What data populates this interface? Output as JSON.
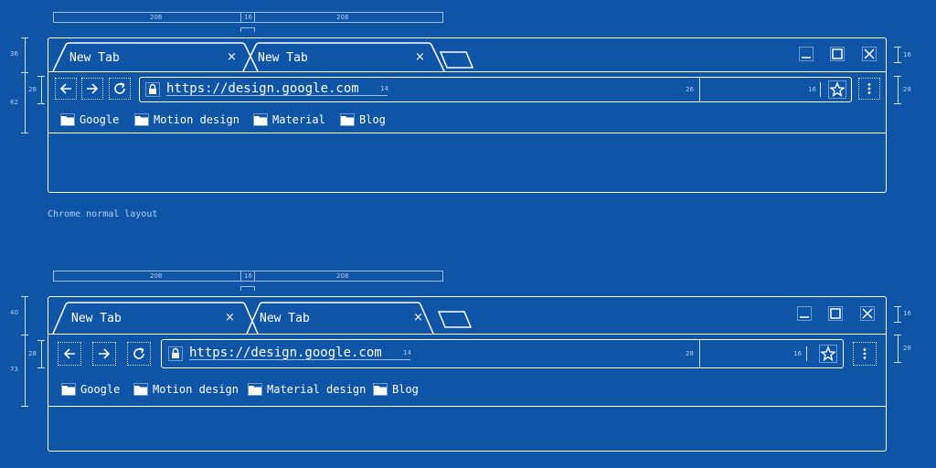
{
  "caption_top": "Chrome normal layout",
  "ruler_top": {
    "tab_width": "208",
    "overlap": "16",
    "tab_width_2": "208"
  },
  "ruler_bottom": {
    "tab_width": "208",
    "overlap": "16",
    "tab_width_2": "208"
  },
  "top_dims": {
    "tabstrip_height": "36",
    "toolbar_height": "28",
    "total_height": "62",
    "winctl_size": "16",
    "menu_size": "28",
    "url_size": "14",
    "omni_height": "26",
    "star_size": "16"
  },
  "bottom_dims": {
    "tabstrip_height": "40",
    "toolbar_height": "28",
    "total_height": "73",
    "winctl_size": "16",
    "menu_size": "28",
    "url_size": "14",
    "omni_height": "28",
    "star_size": "16"
  },
  "top": {
    "tabs": [
      {
        "label": "New Tab"
      },
      {
        "label": "New Tab"
      }
    ],
    "url": "https://design.google.com",
    "bookmarks": [
      {
        "label": "Google"
      },
      {
        "label": "Motion design"
      },
      {
        "label": "Material"
      },
      {
        "label": "Blog"
      }
    ]
  },
  "bottom": {
    "tabs": [
      {
        "label": "New Tab"
      },
      {
        "label": "New Tab"
      }
    ],
    "url": "https://design.google.com",
    "bookmarks": [
      {
        "label": "Google"
      },
      {
        "label": "Motion design"
      },
      {
        "label": "Material design"
      },
      {
        "label": "Blog"
      }
    ]
  },
  "icons": {
    "close": "×"
  }
}
